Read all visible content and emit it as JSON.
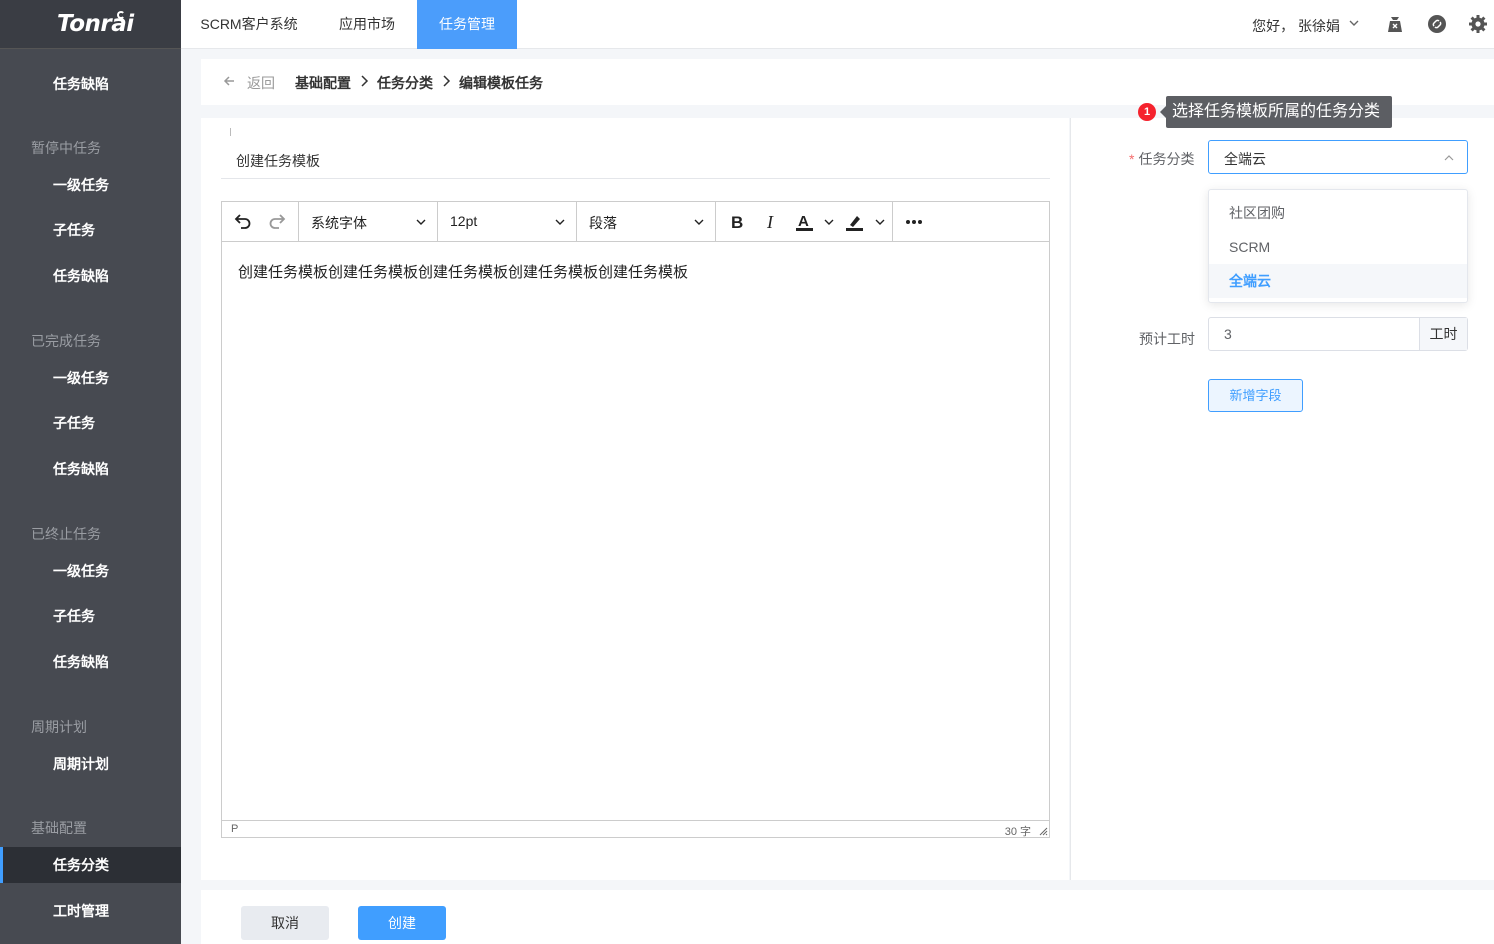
{
  "brand": {
    "logo_text": "Tonrai"
  },
  "sidebar": {
    "groups": [
      {
        "title": "",
        "items": [
          {
            "label": "任务缺陷"
          }
        ]
      },
      {
        "title": "暂停中任务",
        "items": [
          {
            "label": "一级任务"
          },
          {
            "label": "子任务"
          },
          {
            "label": "任务缺陷"
          }
        ]
      },
      {
        "title": "已完成任务",
        "items": [
          {
            "label": "一级任务"
          },
          {
            "label": "子任务"
          },
          {
            "label": "任务缺陷"
          }
        ]
      },
      {
        "title": "已终止任务",
        "items": [
          {
            "label": "一级任务"
          },
          {
            "label": "子任务"
          },
          {
            "label": "任务缺陷"
          }
        ]
      },
      {
        "title": "周期计划",
        "items": [
          {
            "label": "周期计划"
          }
        ]
      },
      {
        "title": "基础配置",
        "items": [
          {
            "label": "任务分类",
            "active": true
          },
          {
            "label": "工时管理"
          }
        ]
      }
    ]
  },
  "topbar": {
    "tabs": [
      {
        "label": "SCRM客户系统"
      },
      {
        "label": "应用市场"
      },
      {
        "label": "任务管理",
        "active": true
      }
    ],
    "greeting": "您好， 张徐娟",
    "icons": [
      "bag-icon",
      "link-icon",
      "settings-icon"
    ]
  },
  "breadcrumb": {
    "back_label": "返回",
    "items": [
      "基础配置",
      "任务分类",
      "编辑模板任务"
    ]
  },
  "editor": {
    "title_value": "创建任务模板",
    "toolbar": {
      "font_family": "系统字体",
      "font_size": "12pt",
      "block_format": "段落"
    },
    "content": "创建任务模板创建任务模板创建任务模板创建任务模板创建任务模板",
    "status_path": "P",
    "word_count": "30 字"
  },
  "form": {
    "tooltip": {
      "badge": "1",
      "text": "选择任务模板所属的任务分类"
    },
    "category_label": "任务分类",
    "category_required_mark": "*",
    "category_value": "全端云",
    "category_options": [
      "社区团购",
      "SCRM",
      "全端云"
    ],
    "category_selected": "全端云",
    "hours_label": "预计工时",
    "hours_value": "3",
    "hours_unit": "工时",
    "add_field_label": "新增字段"
  },
  "footer": {
    "cancel_label": "取消",
    "create_label": "创建"
  },
  "colors": {
    "sidebar_bg": "#474a51",
    "accent": "#409eff",
    "tab_active": "#4b9dfb",
    "badge": "#f5222d"
  }
}
